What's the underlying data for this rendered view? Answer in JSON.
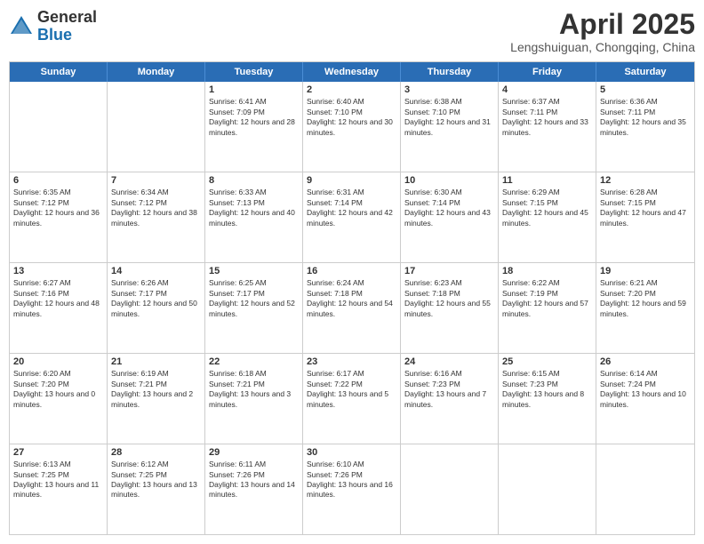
{
  "header": {
    "logo_general": "General",
    "logo_blue": "Blue",
    "title": "April 2025",
    "location": "Lengshuiguan, Chongqing, China"
  },
  "days_of_week": [
    "Sunday",
    "Monday",
    "Tuesday",
    "Wednesday",
    "Thursday",
    "Friday",
    "Saturday"
  ],
  "weeks": [
    [
      {
        "day": "",
        "info": ""
      },
      {
        "day": "",
        "info": ""
      },
      {
        "day": "1",
        "info": "Sunrise: 6:41 AM\nSunset: 7:09 PM\nDaylight: 12 hours and 28 minutes."
      },
      {
        "day": "2",
        "info": "Sunrise: 6:40 AM\nSunset: 7:10 PM\nDaylight: 12 hours and 30 minutes."
      },
      {
        "day": "3",
        "info": "Sunrise: 6:38 AM\nSunset: 7:10 PM\nDaylight: 12 hours and 31 minutes."
      },
      {
        "day": "4",
        "info": "Sunrise: 6:37 AM\nSunset: 7:11 PM\nDaylight: 12 hours and 33 minutes."
      },
      {
        "day": "5",
        "info": "Sunrise: 6:36 AM\nSunset: 7:11 PM\nDaylight: 12 hours and 35 minutes."
      }
    ],
    [
      {
        "day": "6",
        "info": "Sunrise: 6:35 AM\nSunset: 7:12 PM\nDaylight: 12 hours and 36 minutes."
      },
      {
        "day": "7",
        "info": "Sunrise: 6:34 AM\nSunset: 7:12 PM\nDaylight: 12 hours and 38 minutes."
      },
      {
        "day": "8",
        "info": "Sunrise: 6:33 AM\nSunset: 7:13 PM\nDaylight: 12 hours and 40 minutes."
      },
      {
        "day": "9",
        "info": "Sunrise: 6:31 AM\nSunset: 7:14 PM\nDaylight: 12 hours and 42 minutes."
      },
      {
        "day": "10",
        "info": "Sunrise: 6:30 AM\nSunset: 7:14 PM\nDaylight: 12 hours and 43 minutes."
      },
      {
        "day": "11",
        "info": "Sunrise: 6:29 AM\nSunset: 7:15 PM\nDaylight: 12 hours and 45 minutes."
      },
      {
        "day": "12",
        "info": "Sunrise: 6:28 AM\nSunset: 7:15 PM\nDaylight: 12 hours and 47 minutes."
      }
    ],
    [
      {
        "day": "13",
        "info": "Sunrise: 6:27 AM\nSunset: 7:16 PM\nDaylight: 12 hours and 48 minutes."
      },
      {
        "day": "14",
        "info": "Sunrise: 6:26 AM\nSunset: 7:17 PM\nDaylight: 12 hours and 50 minutes."
      },
      {
        "day": "15",
        "info": "Sunrise: 6:25 AM\nSunset: 7:17 PM\nDaylight: 12 hours and 52 minutes."
      },
      {
        "day": "16",
        "info": "Sunrise: 6:24 AM\nSunset: 7:18 PM\nDaylight: 12 hours and 54 minutes."
      },
      {
        "day": "17",
        "info": "Sunrise: 6:23 AM\nSunset: 7:18 PM\nDaylight: 12 hours and 55 minutes."
      },
      {
        "day": "18",
        "info": "Sunrise: 6:22 AM\nSunset: 7:19 PM\nDaylight: 12 hours and 57 minutes."
      },
      {
        "day": "19",
        "info": "Sunrise: 6:21 AM\nSunset: 7:20 PM\nDaylight: 12 hours and 59 minutes."
      }
    ],
    [
      {
        "day": "20",
        "info": "Sunrise: 6:20 AM\nSunset: 7:20 PM\nDaylight: 13 hours and 0 minutes."
      },
      {
        "day": "21",
        "info": "Sunrise: 6:19 AM\nSunset: 7:21 PM\nDaylight: 13 hours and 2 minutes."
      },
      {
        "day": "22",
        "info": "Sunrise: 6:18 AM\nSunset: 7:21 PM\nDaylight: 13 hours and 3 minutes."
      },
      {
        "day": "23",
        "info": "Sunrise: 6:17 AM\nSunset: 7:22 PM\nDaylight: 13 hours and 5 minutes."
      },
      {
        "day": "24",
        "info": "Sunrise: 6:16 AM\nSunset: 7:23 PM\nDaylight: 13 hours and 7 minutes."
      },
      {
        "day": "25",
        "info": "Sunrise: 6:15 AM\nSunset: 7:23 PM\nDaylight: 13 hours and 8 minutes."
      },
      {
        "day": "26",
        "info": "Sunrise: 6:14 AM\nSunset: 7:24 PM\nDaylight: 13 hours and 10 minutes."
      }
    ],
    [
      {
        "day": "27",
        "info": "Sunrise: 6:13 AM\nSunset: 7:25 PM\nDaylight: 13 hours and 11 minutes."
      },
      {
        "day": "28",
        "info": "Sunrise: 6:12 AM\nSunset: 7:25 PM\nDaylight: 13 hours and 13 minutes."
      },
      {
        "day": "29",
        "info": "Sunrise: 6:11 AM\nSunset: 7:26 PM\nDaylight: 13 hours and 14 minutes."
      },
      {
        "day": "30",
        "info": "Sunrise: 6:10 AM\nSunset: 7:26 PM\nDaylight: 13 hours and 16 minutes."
      },
      {
        "day": "",
        "info": ""
      },
      {
        "day": "",
        "info": ""
      },
      {
        "day": "",
        "info": ""
      }
    ]
  ]
}
